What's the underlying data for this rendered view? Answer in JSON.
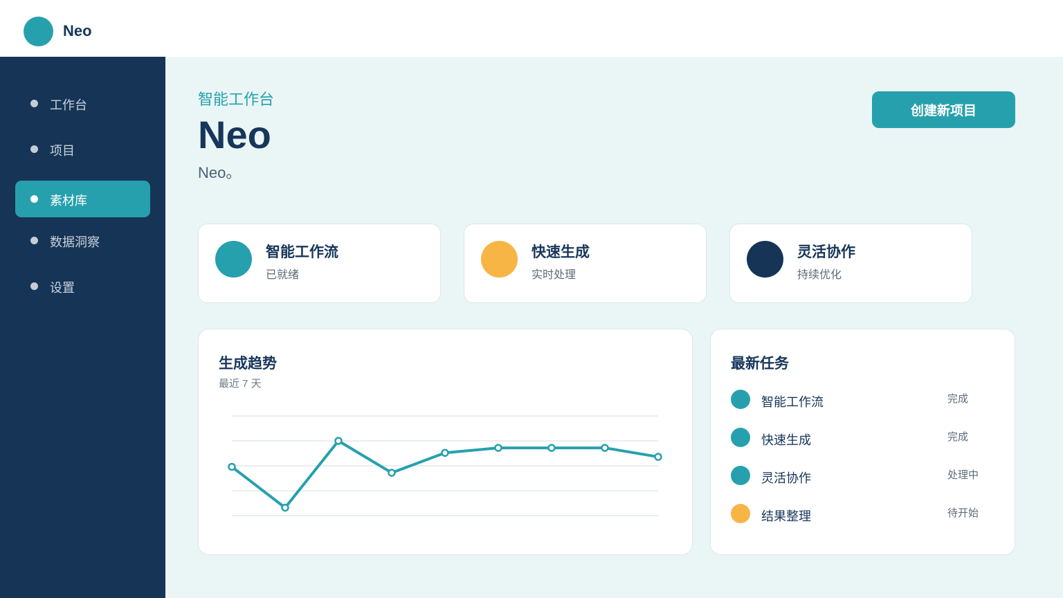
{
  "app": {
    "name": "Neo"
  },
  "colors": {
    "accent": "#27a0ad",
    "orange": "#f7b546",
    "navy": "#163456"
  },
  "sidebar": {
    "items": [
      {
        "label": "工作台",
        "active": false
      },
      {
        "label": "项目",
        "active": false
      },
      {
        "label": "素材库",
        "active": true
      },
      {
        "label": "数据洞察",
        "active": false
      },
      {
        "label": "设置",
        "active": false
      }
    ]
  },
  "header": {
    "eyebrow": "智能工作台",
    "title": "Neo",
    "subtitle": "Neo。",
    "create_button": "创建新项目"
  },
  "stats": [
    {
      "title": "智能工作流",
      "subtitle": "已就绪",
      "color": "#27a0ad"
    },
    {
      "title": "快速生成",
      "subtitle": "实时处理",
      "color": "#f7b546"
    },
    {
      "title": "灵活协作",
      "subtitle": "持续优化",
      "color": "#163456"
    }
  ],
  "trend": {
    "title": "生成趋势",
    "subtitle": "最近 7 天"
  },
  "chart_data": {
    "type": "line",
    "x": [
      1,
      2,
      3,
      4,
      5,
      6,
      7,
      8,
      9
    ],
    "values": [
      49,
      8,
      75,
      43,
      63,
      68,
      68,
      68,
      59
    ],
    "ylim": [
      0,
      100
    ],
    "grid": true,
    "color": "#27a0ad"
  },
  "tasks": {
    "title": "最新任务",
    "items": [
      {
        "name": "智能工作流",
        "status": "完成",
        "color": "#27a0ad"
      },
      {
        "name": "快速生成",
        "status": "完成",
        "color": "#27a0ad"
      },
      {
        "name": "灵活协作",
        "status": "处理中",
        "color": "#27a0ad"
      },
      {
        "name": "结果整理",
        "status": "待开始",
        "color": "#f7b546"
      }
    ]
  }
}
